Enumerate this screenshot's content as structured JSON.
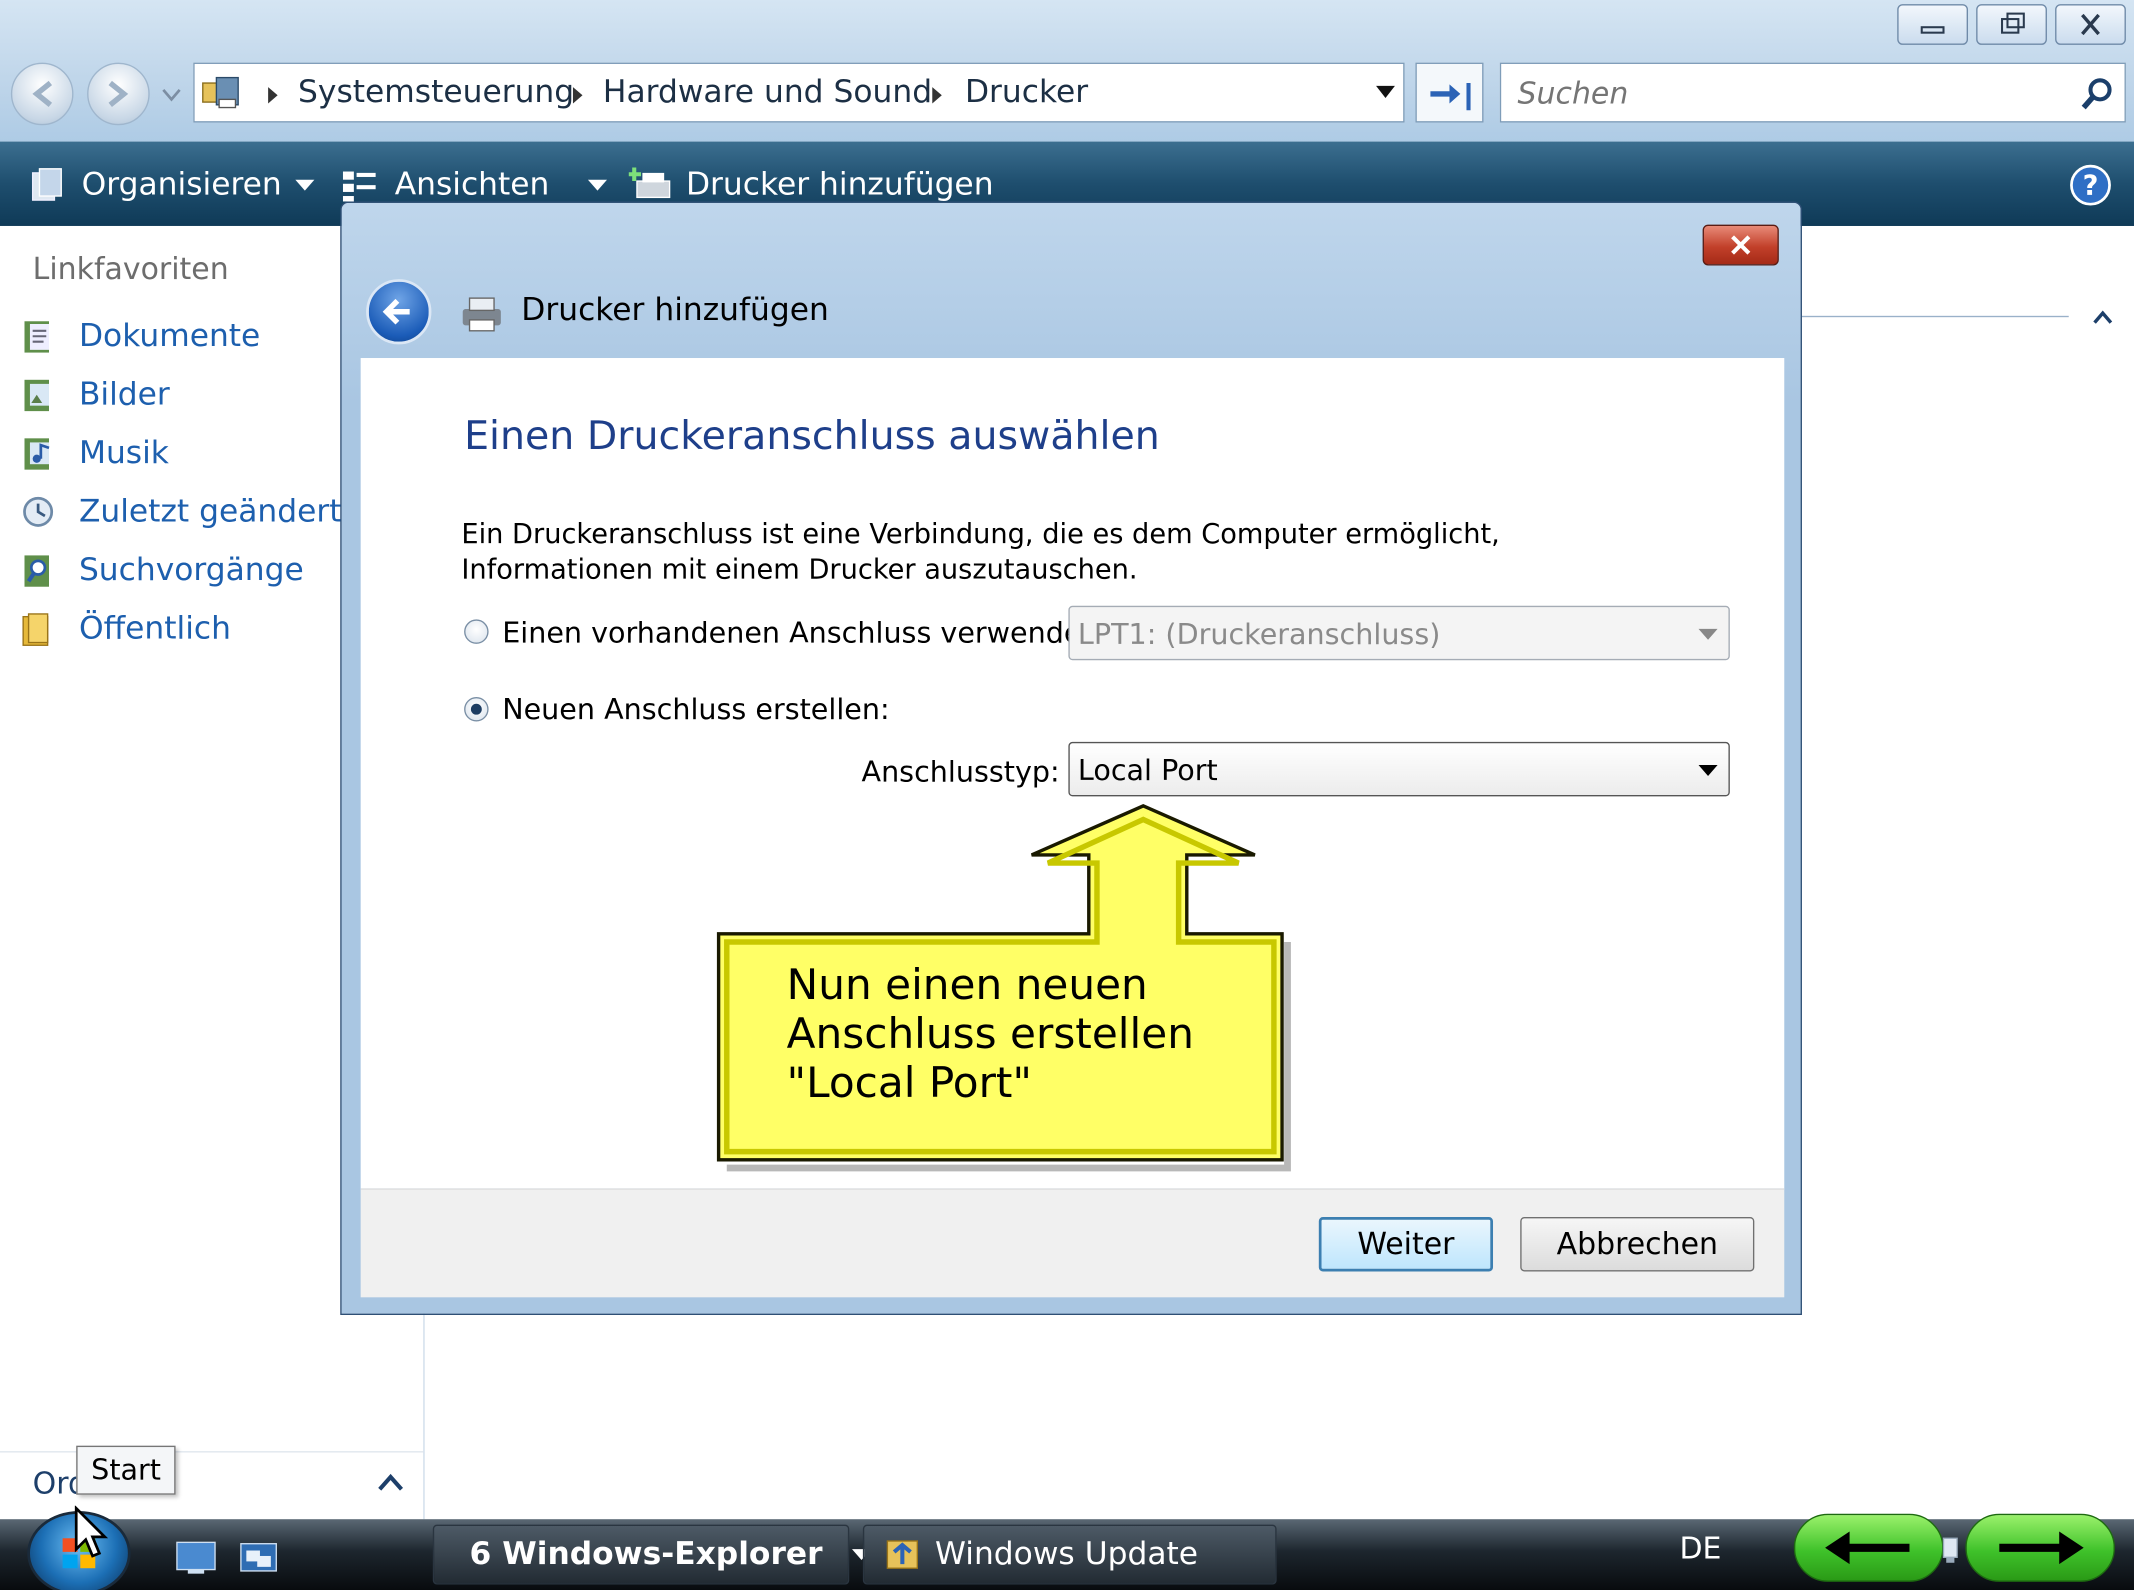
{
  "window": {
    "breadcrumb": [
      "Systemsteuerung",
      "Hardware und Sound",
      "Drucker"
    ],
    "search_placeholder": "Suchen"
  },
  "toolbar": {
    "organize": "Organisieren",
    "views": "Ansichten",
    "add_printer": "Drucker hinzufügen"
  },
  "sidebar": {
    "heading": "Linkfavoriten",
    "items": [
      {
        "label": "Dokumente",
        "icon": "documents-icon"
      },
      {
        "label": "Bilder",
        "icon": "pictures-icon"
      },
      {
        "label": "Musik",
        "icon": "music-icon"
      },
      {
        "label": "Zuletzt geändert",
        "icon": "recent-icon"
      },
      {
        "label": "Suchvorgänge",
        "icon": "searches-icon"
      },
      {
        "label": "Öffentlich",
        "icon": "public-folder-icon"
      }
    ],
    "folders_label": "Ord"
  },
  "dialog": {
    "title": "Drucker hinzufügen",
    "heading": "Einen Druckeranschluss auswählen",
    "description": "Ein Druckeranschluss ist eine Verbindung, die es dem Computer ermöglicht, Informationen mit einem Drucker auszutauschen.",
    "option_existing": "Einen vorhandenen Anschluss verwenden:",
    "existing_port_value": "LPT1: (Druckeranschluss)",
    "option_new": "Neuen Anschluss erstellen:",
    "selected_option": "new",
    "port_type_label": "Anschlusstyp:",
    "port_type_value": "Local Port",
    "next_button": "Weiter",
    "cancel_button": "Abbrechen"
  },
  "callout": {
    "lines": [
      "Nun einen neuen",
      "Anschluss erstellen",
      "\"Local Port\""
    ]
  },
  "taskbar": {
    "explorer_group": "6 Windows-Explorer",
    "windows_update": "Windows Update",
    "language": "DE",
    "start_tooltip": "Start"
  },
  "colors": {
    "toolbar": "#1e4e6e",
    "link_blue": "#1d5fae",
    "heading_blue": "#1e3f8a",
    "callout_fill": "#ffff66",
    "callout_border": "#c8c800",
    "nav_arrow_green": "#3fc22a"
  }
}
